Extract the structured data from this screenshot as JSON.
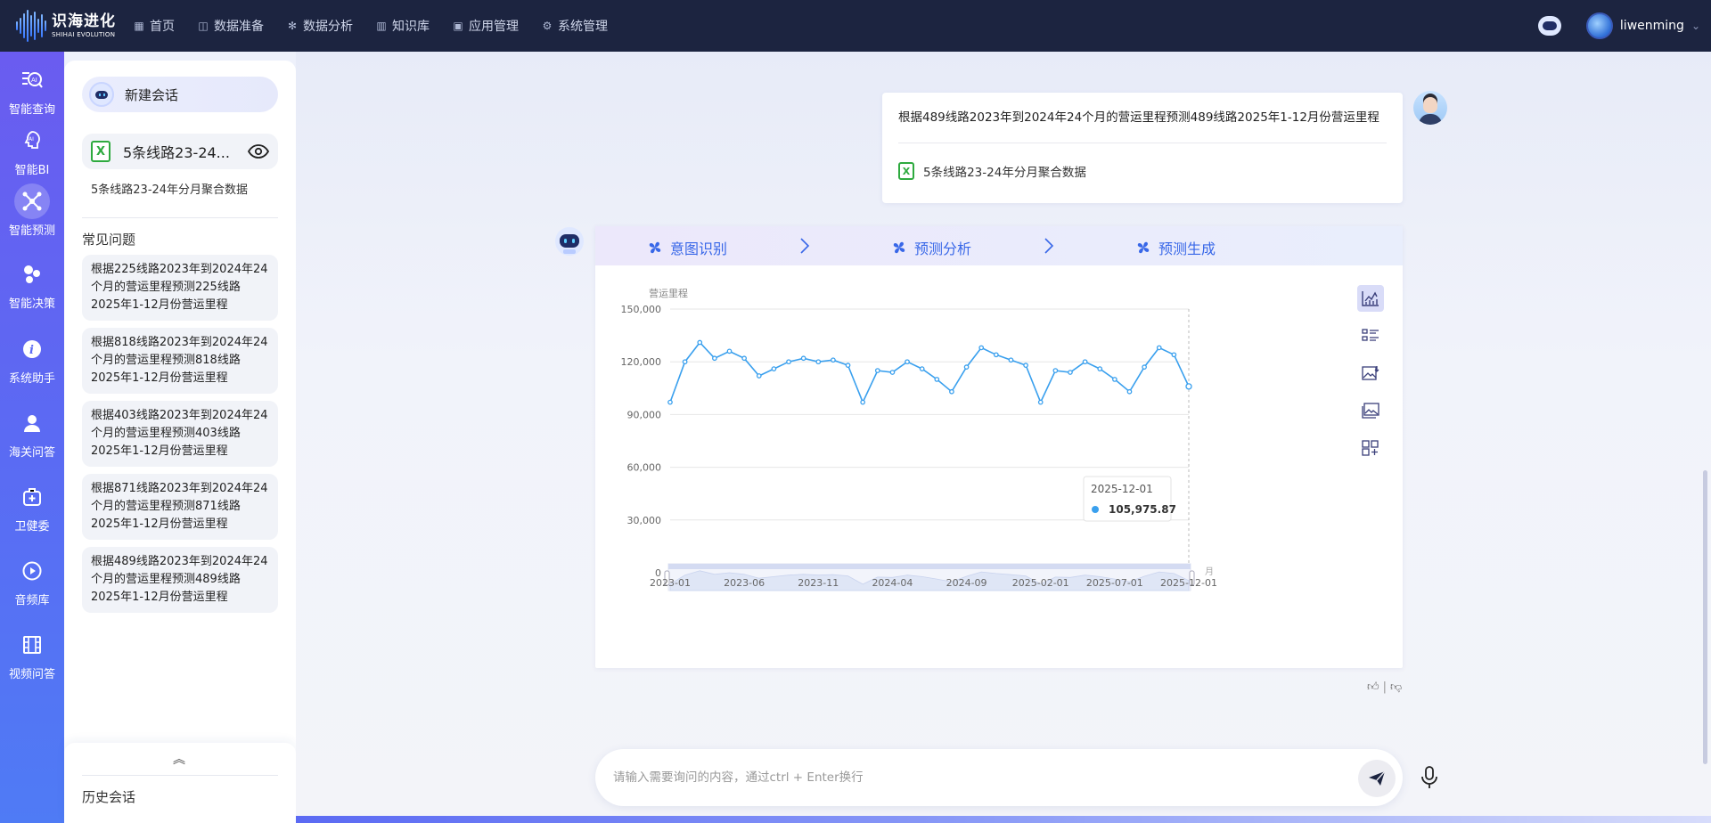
{
  "brand": {
    "name_cn": "识海进化",
    "name_en": "SHIHAI EVOLUTION"
  },
  "nav": [
    {
      "label": "首页",
      "icon": "grid-icon"
    },
    {
      "label": "数据准备",
      "icon": "database-icon"
    },
    {
      "label": "数据分析",
      "icon": "gear-icon"
    },
    {
      "label": "知识库",
      "icon": "book-icon"
    },
    {
      "label": "应用管理",
      "icon": "app-icon"
    },
    {
      "label": "系统管理",
      "icon": "settings-icon"
    }
  ],
  "user": {
    "name": "liwenming"
  },
  "rail": [
    {
      "label": "智能查询",
      "icon": "ai-search-icon",
      "active": false
    },
    {
      "label": "智能BI",
      "icon": "ai-bi-icon",
      "active": false
    },
    {
      "label": "智能预测",
      "icon": "network-icon",
      "active": true
    },
    {
      "label": "智能决策",
      "icon": "molecule-icon",
      "active": false
    },
    {
      "label": "系统助手",
      "icon": "info-icon",
      "active": false
    },
    {
      "label": "海关问答",
      "icon": "person-icon",
      "active": false
    },
    {
      "label": "卫健委",
      "icon": "medical-kit-icon",
      "active": false
    },
    {
      "label": "音频库",
      "icon": "play-icon",
      "active": false
    },
    {
      "label": "视频问答",
      "icon": "film-icon",
      "active": false
    }
  ],
  "panel": {
    "new_chat": "新建会话",
    "file_name": "5条线路23-24...",
    "file_desc": "5条线路23-24年分月聚合数据",
    "faq_title": "常见问题",
    "faq": [
      "根据225线路2023年到2024年24个月的营运里程预测225线路2025年1-12月份营运里程",
      "根据818线路2023年到2024年24个月的营运里程预测818线路2025年1-12月份营运里程",
      "根据403线路2023年到2024年24个月的营运里程预测403线路2025年1-12月份营运里程",
      "根据871线路2023年到2024年24个月的营运里程预测871线路2025年1-12月份营运里程",
      "根据489线路2023年到2024年24个月的营运里程预测489线路2025年1-12月份营运里程"
    ],
    "history_title": "历史会话"
  },
  "conversation": {
    "user_message": "根据489线路2023年到2024年24个月的营运里程预测489线路2025年1-12月份营运里程",
    "user_file": "5条线路23-24年分月聚合数据",
    "steps": [
      "意图识别",
      "预测分析",
      "预测生成"
    ]
  },
  "input": {
    "placeholder": "请输入需要询问的内容，通过ctrl + Enter换行"
  },
  "colors": {
    "accent": "#3867e8",
    "line": "#3aa0ee",
    "topbar": "#1c2440"
  },
  "chart_data": {
    "type": "line",
    "ylabel": "营运里程",
    "ylim": [
      0,
      150000
    ],
    "yticks": [
      "0",
      "30,000",
      "60,000",
      "90,000",
      "120,000",
      "150,000"
    ],
    "xticks": [
      "2023-01",
      "2023-06",
      "2023-11",
      "2024-04",
      "2024-09",
      "2025-02-01",
      "2025-07-01",
      "2025-12-01"
    ],
    "x": [
      "2023-01",
      "2023-02",
      "2023-03",
      "2023-04",
      "2023-05",
      "2023-06",
      "2023-07",
      "2023-08",
      "2023-09",
      "2023-10",
      "2023-11",
      "2023-12",
      "2024-01",
      "2024-02",
      "2024-03",
      "2024-04",
      "2024-05",
      "2024-06",
      "2024-07",
      "2024-08",
      "2024-09",
      "2024-10",
      "2024-11",
      "2024-12",
      "2025-01-01",
      "2025-02-01",
      "2025-03-01",
      "2025-04-01",
      "2025-05-01",
      "2025-06-01",
      "2025-07-01",
      "2025-08-01",
      "2025-09-01",
      "2025-10-01",
      "2025-11-01",
      "2025-12-01"
    ],
    "series": [
      {
        "values": [
          97000,
          120000,
          131000,
          122000,
          126000,
          122000,
          112000,
          116000,
          120000,
          122000,
          120000,
          121000,
          118000,
          97000,
          115000,
          114000,
          120000,
          116000,
          110000,
          103000,
          117000,
          128000,
          124000,
          121000,
          118000,
          97000,
          115000,
          114000,
          120000,
          116000,
          110000,
          103000,
          117000,
          128000,
          124000,
          105975.87
        ]
      }
    ],
    "tooltip": {
      "date": "2025-12-01",
      "value": "105,975.87"
    },
    "month_label": "月",
    "grid": true
  }
}
